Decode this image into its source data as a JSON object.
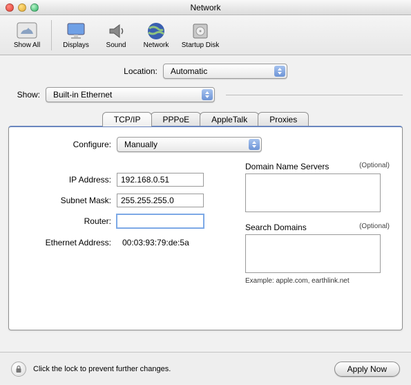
{
  "window": {
    "title": "Network"
  },
  "toolbar": {
    "show_all": "Show All",
    "displays": "Displays",
    "sound": "Sound",
    "network": "Network",
    "startup_disk": "Startup Disk"
  },
  "location": {
    "label": "Location:",
    "value": "Automatic"
  },
  "show": {
    "label": "Show:",
    "value": "Built-in Ethernet"
  },
  "tabs": {
    "tcpip": "TCP/IP",
    "pppoe": "PPPoE",
    "appletalk": "AppleTalk",
    "proxies": "Proxies"
  },
  "tcpip": {
    "configure_label": "Configure:",
    "configure_value": "Manually",
    "ip_label": "IP Address:",
    "ip_value": "192.168.0.51",
    "subnet_label": "Subnet Mask:",
    "subnet_value": "255.255.255.0",
    "router_label": "Router:",
    "router_value": "",
    "dns_heading": "Domain Name Servers",
    "optional": "(Optional)",
    "search_heading": "Search Domains",
    "example_label": "Example: apple.com, earthlink.net",
    "ethernet_label": "Ethernet Address:",
    "ethernet_value": "00:03:93:79:de:5a"
  },
  "footer": {
    "lock_text": "Click the lock to prevent further changes.",
    "apply": "Apply Now"
  }
}
